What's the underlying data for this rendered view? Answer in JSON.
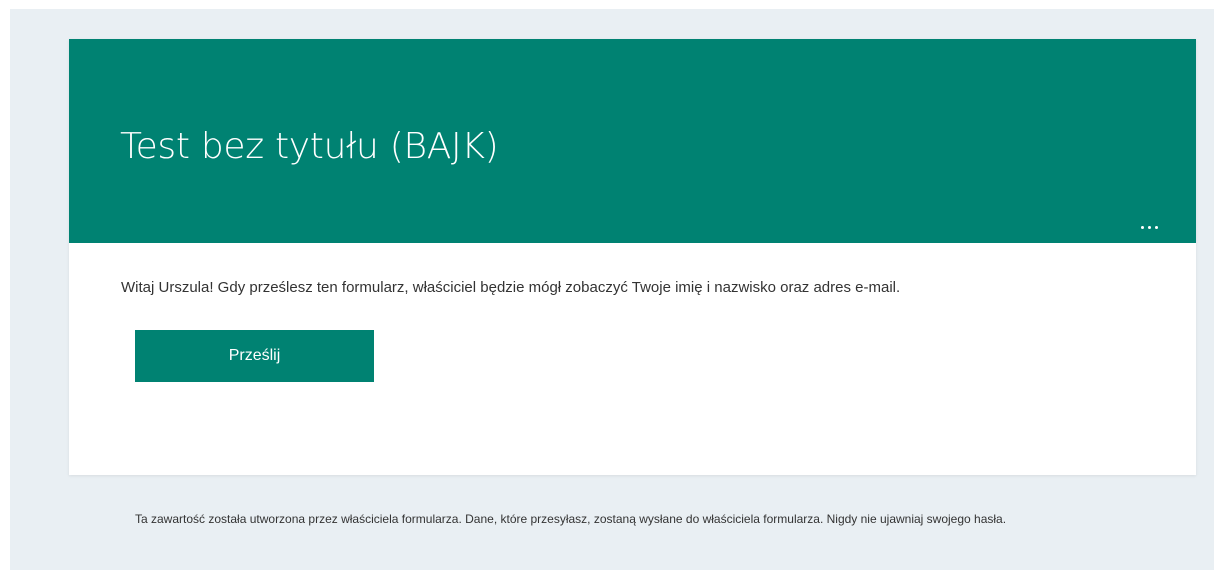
{
  "form": {
    "title": "Test bez tytułu (BAJK)",
    "more_options_icon": "ellipsis-icon",
    "welcome_message": "Witaj Urszula! Gdy prześlesz ten formularz, właściciel będzie mógł zobaczyć Twoje imię i nazwisko oraz adres e-mail.",
    "submit_label": "Prześlij"
  },
  "footer": {
    "disclaimer": "Ta zawartość została utworzona przez właściciela formularza. Dane, które przesyłasz, zostaną wysłane do właściciela formularza. Nigdy nie ujawniaj swojego hasła."
  },
  "colors": {
    "accent": "#008272",
    "page_background": "#e9eff3",
    "card_background": "#ffffff",
    "text": "#333333"
  }
}
